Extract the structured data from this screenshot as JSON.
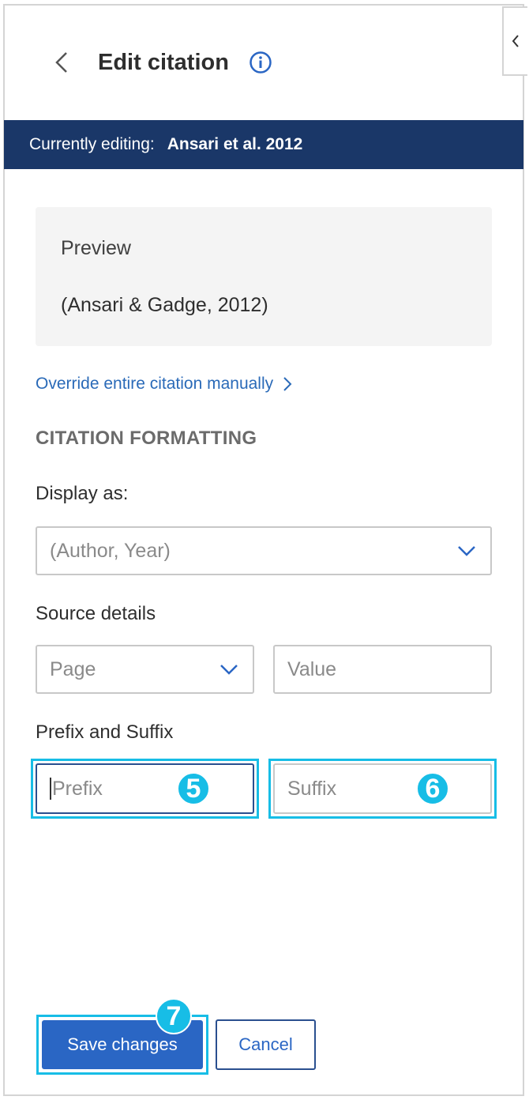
{
  "header": {
    "title": "Edit citation",
    "back_icon": "chevron-left-icon",
    "info_icon": "info-icon",
    "collapse_icon": "chevron-left-icon"
  },
  "editing": {
    "label": "Currently editing:",
    "value": "Ansari et al. 2012"
  },
  "preview": {
    "title": "Preview",
    "text": "(Ansari & Gadge, 2012)"
  },
  "override_link": "Override entire citation manually",
  "section_title": "CITATION FORMATTING",
  "display_as": {
    "label": "Display as:",
    "selected": "(Author, Year)"
  },
  "source_details": {
    "label": "Source details",
    "type_selected": "Page",
    "value_placeholder": "Value"
  },
  "prefix_suffix": {
    "label": "Prefix and Suffix",
    "prefix_placeholder": "Prefix",
    "suffix_placeholder": "Suffix"
  },
  "badges": {
    "prefix": "5",
    "suffix": "6",
    "save": "7"
  },
  "buttons": {
    "save": "Save changes",
    "cancel": "Cancel"
  },
  "colors": {
    "accent": "#2a66c4",
    "banner": "#1a3768",
    "highlight": "#17bde6"
  }
}
